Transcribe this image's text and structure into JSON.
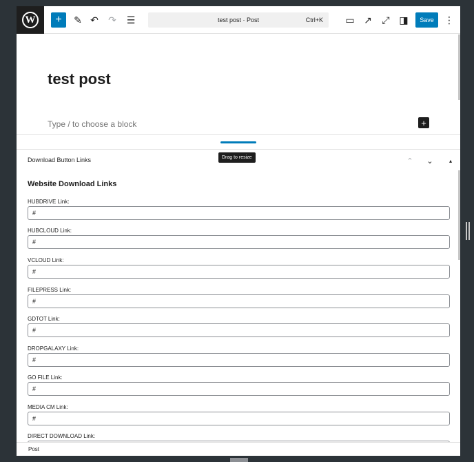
{
  "toolbar": {
    "logo_letter": "W",
    "add_label": "+",
    "edit_icon": "✎",
    "undo_icon": "↶",
    "redo_icon": "↷",
    "list_icon": "☰",
    "command_title": "test post · Post",
    "command_shortcut": "Ctrl+K",
    "preview_icon": "▭",
    "view_post_icon": "↗",
    "fullscreen_icon": "⤢",
    "sidebar_icon": "◨",
    "save_label": "Save",
    "options_icon": "⋮"
  },
  "canvas": {
    "title": "test post",
    "placeholder": "Type / to choose a block",
    "inserter_label": "+"
  },
  "resize": {
    "tooltip": "Drag to resize"
  },
  "metabox": {
    "title": "Download Button Links",
    "up_icon": "⌃",
    "down_icon": "⌄",
    "toggle_icon": "▴",
    "section_heading": "Website Download Links",
    "fields": [
      {
        "label": "HUBDRIVE Link:",
        "value": "#"
      },
      {
        "label": "HUBCLOUD Link:",
        "value": "#"
      },
      {
        "label": "VCLOUD Link:",
        "value": "#"
      },
      {
        "label": "FILEPRESS Link:",
        "value": "#"
      },
      {
        "label": "GDTOT Link:",
        "value": "#"
      },
      {
        "label": "DROPGALAXY Link:",
        "value": "#"
      },
      {
        "label": "GO FILE Link:",
        "value": "#"
      },
      {
        "label": "MEDIA CM Link:",
        "value": "#"
      },
      {
        "label": "DIRECT DOWNLOAD Link:",
        "value": ""
      }
    ]
  },
  "footer": {
    "breadcrumb": "Post"
  }
}
